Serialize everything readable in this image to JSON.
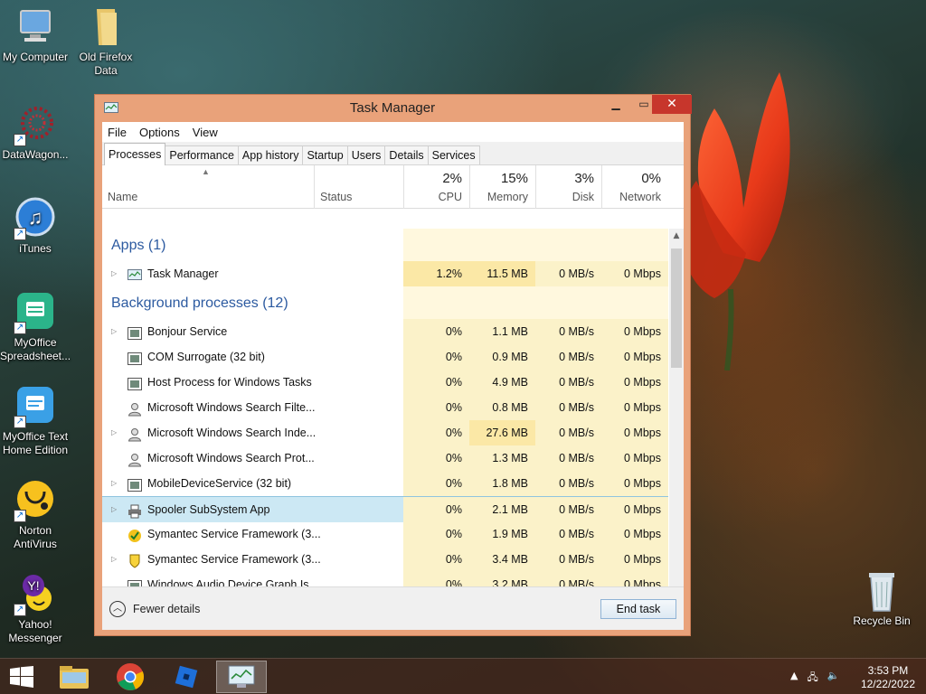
{
  "desktop": {
    "icons": [
      {
        "label": "My Computer"
      },
      {
        "label": "Old Firefox Data"
      },
      {
        "label": "DataWagon..."
      },
      {
        "label": "iTunes"
      },
      {
        "label": "MyOffice Spreadsheet..."
      },
      {
        "label": "MyOffice Text Home Edition"
      },
      {
        "label": "Norton AntiVirus"
      },
      {
        "label": "Yahoo! Messenger"
      },
      {
        "label": "Recycle Bin"
      }
    ]
  },
  "window": {
    "title": "Task Manager",
    "menu": [
      "File",
      "Options",
      "View"
    ],
    "tabs": [
      "Processes",
      "Performance",
      "App history",
      "Startup",
      "Users",
      "Details",
      "Services"
    ],
    "active_tab": "Processes",
    "columns": {
      "name": "Name",
      "status": "Status",
      "cpu": {
        "pct": "2%",
        "label": "CPU"
      },
      "memory": {
        "pct": "15%",
        "label": "Memory"
      },
      "disk": {
        "pct": "3%",
        "label": "Disk"
      },
      "network": {
        "pct": "0%",
        "label": "Network"
      }
    },
    "groups": [
      {
        "title": "Apps (1)",
        "rows": [
          {
            "name": "Task Manager",
            "icon": "task-manager-icon",
            "expandable": true,
            "cpu": "1.2%",
            "memory": "11.5 MB",
            "disk": "0 MB/s",
            "network": "0 Mbps"
          }
        ]
      },
      {
        "title": "Background processes (12)",
        "rows": [
          {
            "name": "Bonjour Service",
            "icon": "service-icon",
            "expandable": true,
            "cpu": "0%",
            "memory": "1.1 MB",
            "disk": "0 MB/s",
            "network": "0 Mbps"
          },
          {
            "name": "COM Surrogate (32 bit)",
            "icon": "service-icon",
            "expandable": false,
            "cpu": "0%",
            "memory": "0.9 MB",
            "disk": "0 MB/s",
            "network": "0 Mbps"
          },
          {
            "name": "Host Process for Windows Tasks",
            "icon": "service-icon",
            "expandable": false,
            "cpu": "0%",
            "memory": "4.9 MB",
            "disk": "0 MB/s",
            "network": "0 Mbps"
          },
          {
            "name": "Microsoft Windows Search Filte...",
            "icon": "search-user-icon",
            "expandable": false,
            "cpu": "0%",
            "memory": "0.8 MB",
            "disk": "0 MB/s",
            "network": "0 Mbps"
          },
          {
            "name": "Microsoft Windows Search Inde...",
            "icon": "search-user-icon",
            "expandable": true,
            "cpu": "0%",
            "memory": "27.6 MB",
            "disk": "0 MB/s",
            "network": "0 Mbps"
          },
          {
            "name": "Microsoft Windows Search Prot...",
            "icon": "search-user-icon",
            "expandable": false,
            "cpu": "0%",
            "memory": "1.3 MB",
            "disk": "0 MB/s",
            "network": "0 Mbps"
          },
          {
            "name": "MobileDeviceService (32 bit)",
            "icon": "service-icon",
            "expandable": true,
            "cpu": "0%",
            "memory": "1.8 MB",
            "disk": "0 MB/s",
            "network": "0 Mbps"
          },
          {
            "name": "Spooler SubSystem App",
            "icon": "printer-icon",
            "expandable": true,
            "selected": true,
            "cpu": "0%",
            "memory": "2.1 MB",
            "disk": "0 MB/s",
            "network": "0 Mbps"
          },
          {
            "name": "Symantec Service Framework (3...",
            "icon": "symantec-icon",
            "expandable": false,
            "cpu": "0%",
            "memory": "1.9 MB",
            "disk": "0 MB/s",
            "network": "0 Mbps"
          },
          {
            "name": "Symantec Service Framework (3...",
            "icon": "symantec-shield-icon",
            "expandable": true,
            "cpu": "0%",
            "memory": "3.4 MB",
            "disk": "0 MB/s",
            "network": "0 Mbps"
          },
          {
            "name": "Windows Audio Device Graph Is...",
            "icon": "service-icon",
            "expandable": false,
            "cpu": "0%",
            "memory": "3.2 MB",
            "disk": "0 MB/s",
            "network": "0 Mbps"
          }
        ]
      }
    ],
    "footer": {
      "fewer_details": "Fewer details",
      "end_task": "End task"
    }
  },
  "taskbar": {
    "time": "3:53 PM",
    "date": "12/22/2022"
  }
}
